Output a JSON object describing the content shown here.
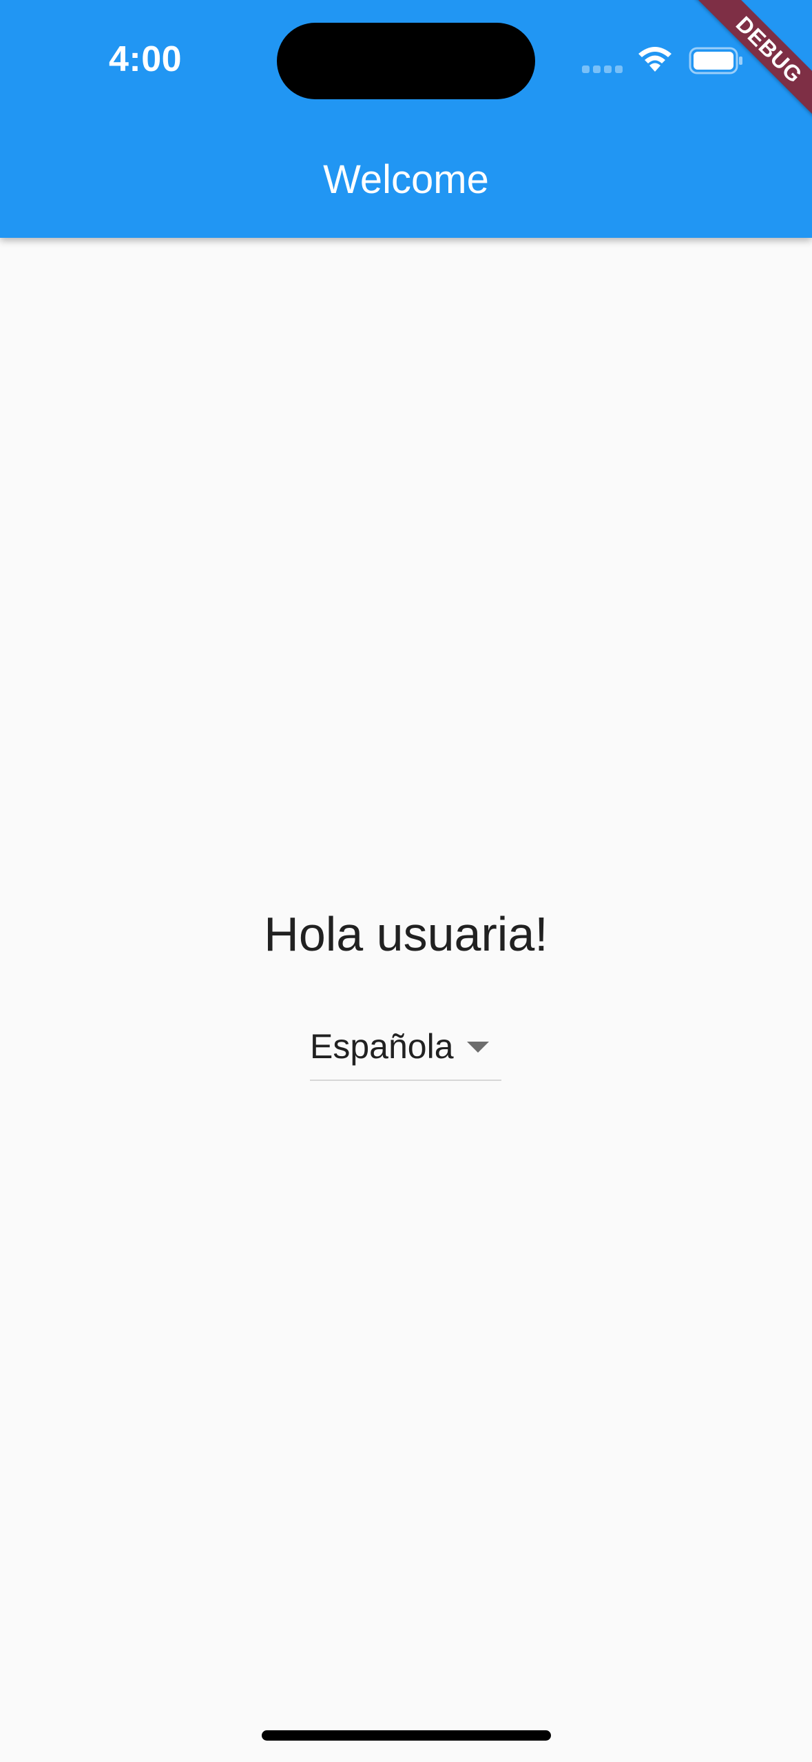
{
  "status_bar": {
    "time": "4:00"
  },
  "app_bar": {
    "title": "Welcome",
    "color": "#2196f3"
  },
  "debug_banner": {
    "label": "DEBUG",
    "color": "#7e2f45"
  },
  "main": {
    "greeting": "Hola usuaria!",
    "language_dropdown": {
      "selected": "Española"
    }
  },
  "icons": {
    "signal": "cellular-signal-icon",
    "wifi": "wifi-icon",
    "battery": "battery-icon",
    "dropdown": "dropdown-arrow-icon"
  }
}
